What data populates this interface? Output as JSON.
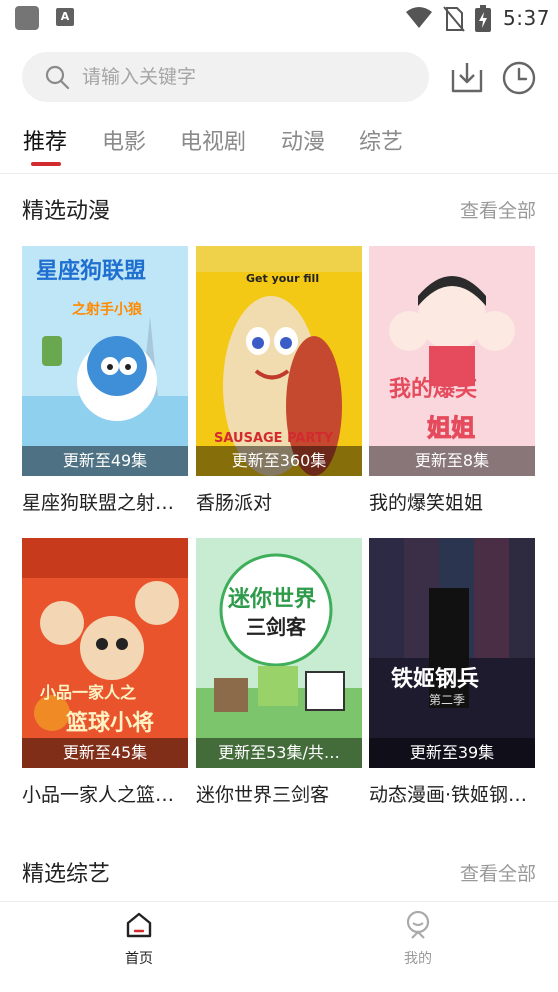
{
  "status_bar": {
    "time": "5:37",
    "app_badge": "A"
  },
  "search": {
    "placeholder": "请输入关键字"
  },
  "tabs": [
    {
      "label": "推荐",
      "active": true
    },
    {
      "label": "电影",
      "active": false
    },
    {
      "label": "电视剧",
      "active": false
    },
    {
      "label": "动漫",
      "active": false
    },
    {
      "label": "综艺",
      "active": false
    }
  ],
  "sections": [
    {
      "title": "精选动漫",
      "more_label": "查看全部",
      "items": [
        {
          "title": "星座狗联盟之射…",
          "badge": "更新至49集",
          "poster_text": "星座狗联盟",
          "poster_sub": "之射手小狼"
        },
        {
          "title": "香肠派对",
          "badge": "更新至360集",
          "poster_text": "Get your fill",
          "poster_sub": "SAUSAGE PARTY"
        },
        {
          "title": "我的爆笑姐姐",
          "badge": "更新至8集",
          "poster_text": "我的爆笑",
          "poster_sub": "姐姐"
        },
        {
          "title": "小品一家人之篮…",
          "badge": "更新至45集",
          "poster_text": "小品一家人之",
          "poster_sub": "篮球小将"
        },
        {
          "title": "迷你世界三剑客",
          "badge": "更新至53集/共…",
          "poster_text": "迷你世界",
          "poster_sub": "三剑客"
        },
        {
          "title": "动态漫画·铁姬钢…",
          "badge": "更新至39集",
          "poster_text": "铁姬钢兵",
          "poster_sub": "第二季"
        }
      ]
    },
    {
      "title": "精选综艺",
      "more_label": "查看全部"
    }
  ],
  "bottom_nav": [
    {
      "label": "首页",
      "active": true
    },
    {
      "label": "我的",
      "active": false
    }
  ],
  "colors": {
    "accent": "#d32a2f",
    "inactive": "#9a9a9a"
  }
}
